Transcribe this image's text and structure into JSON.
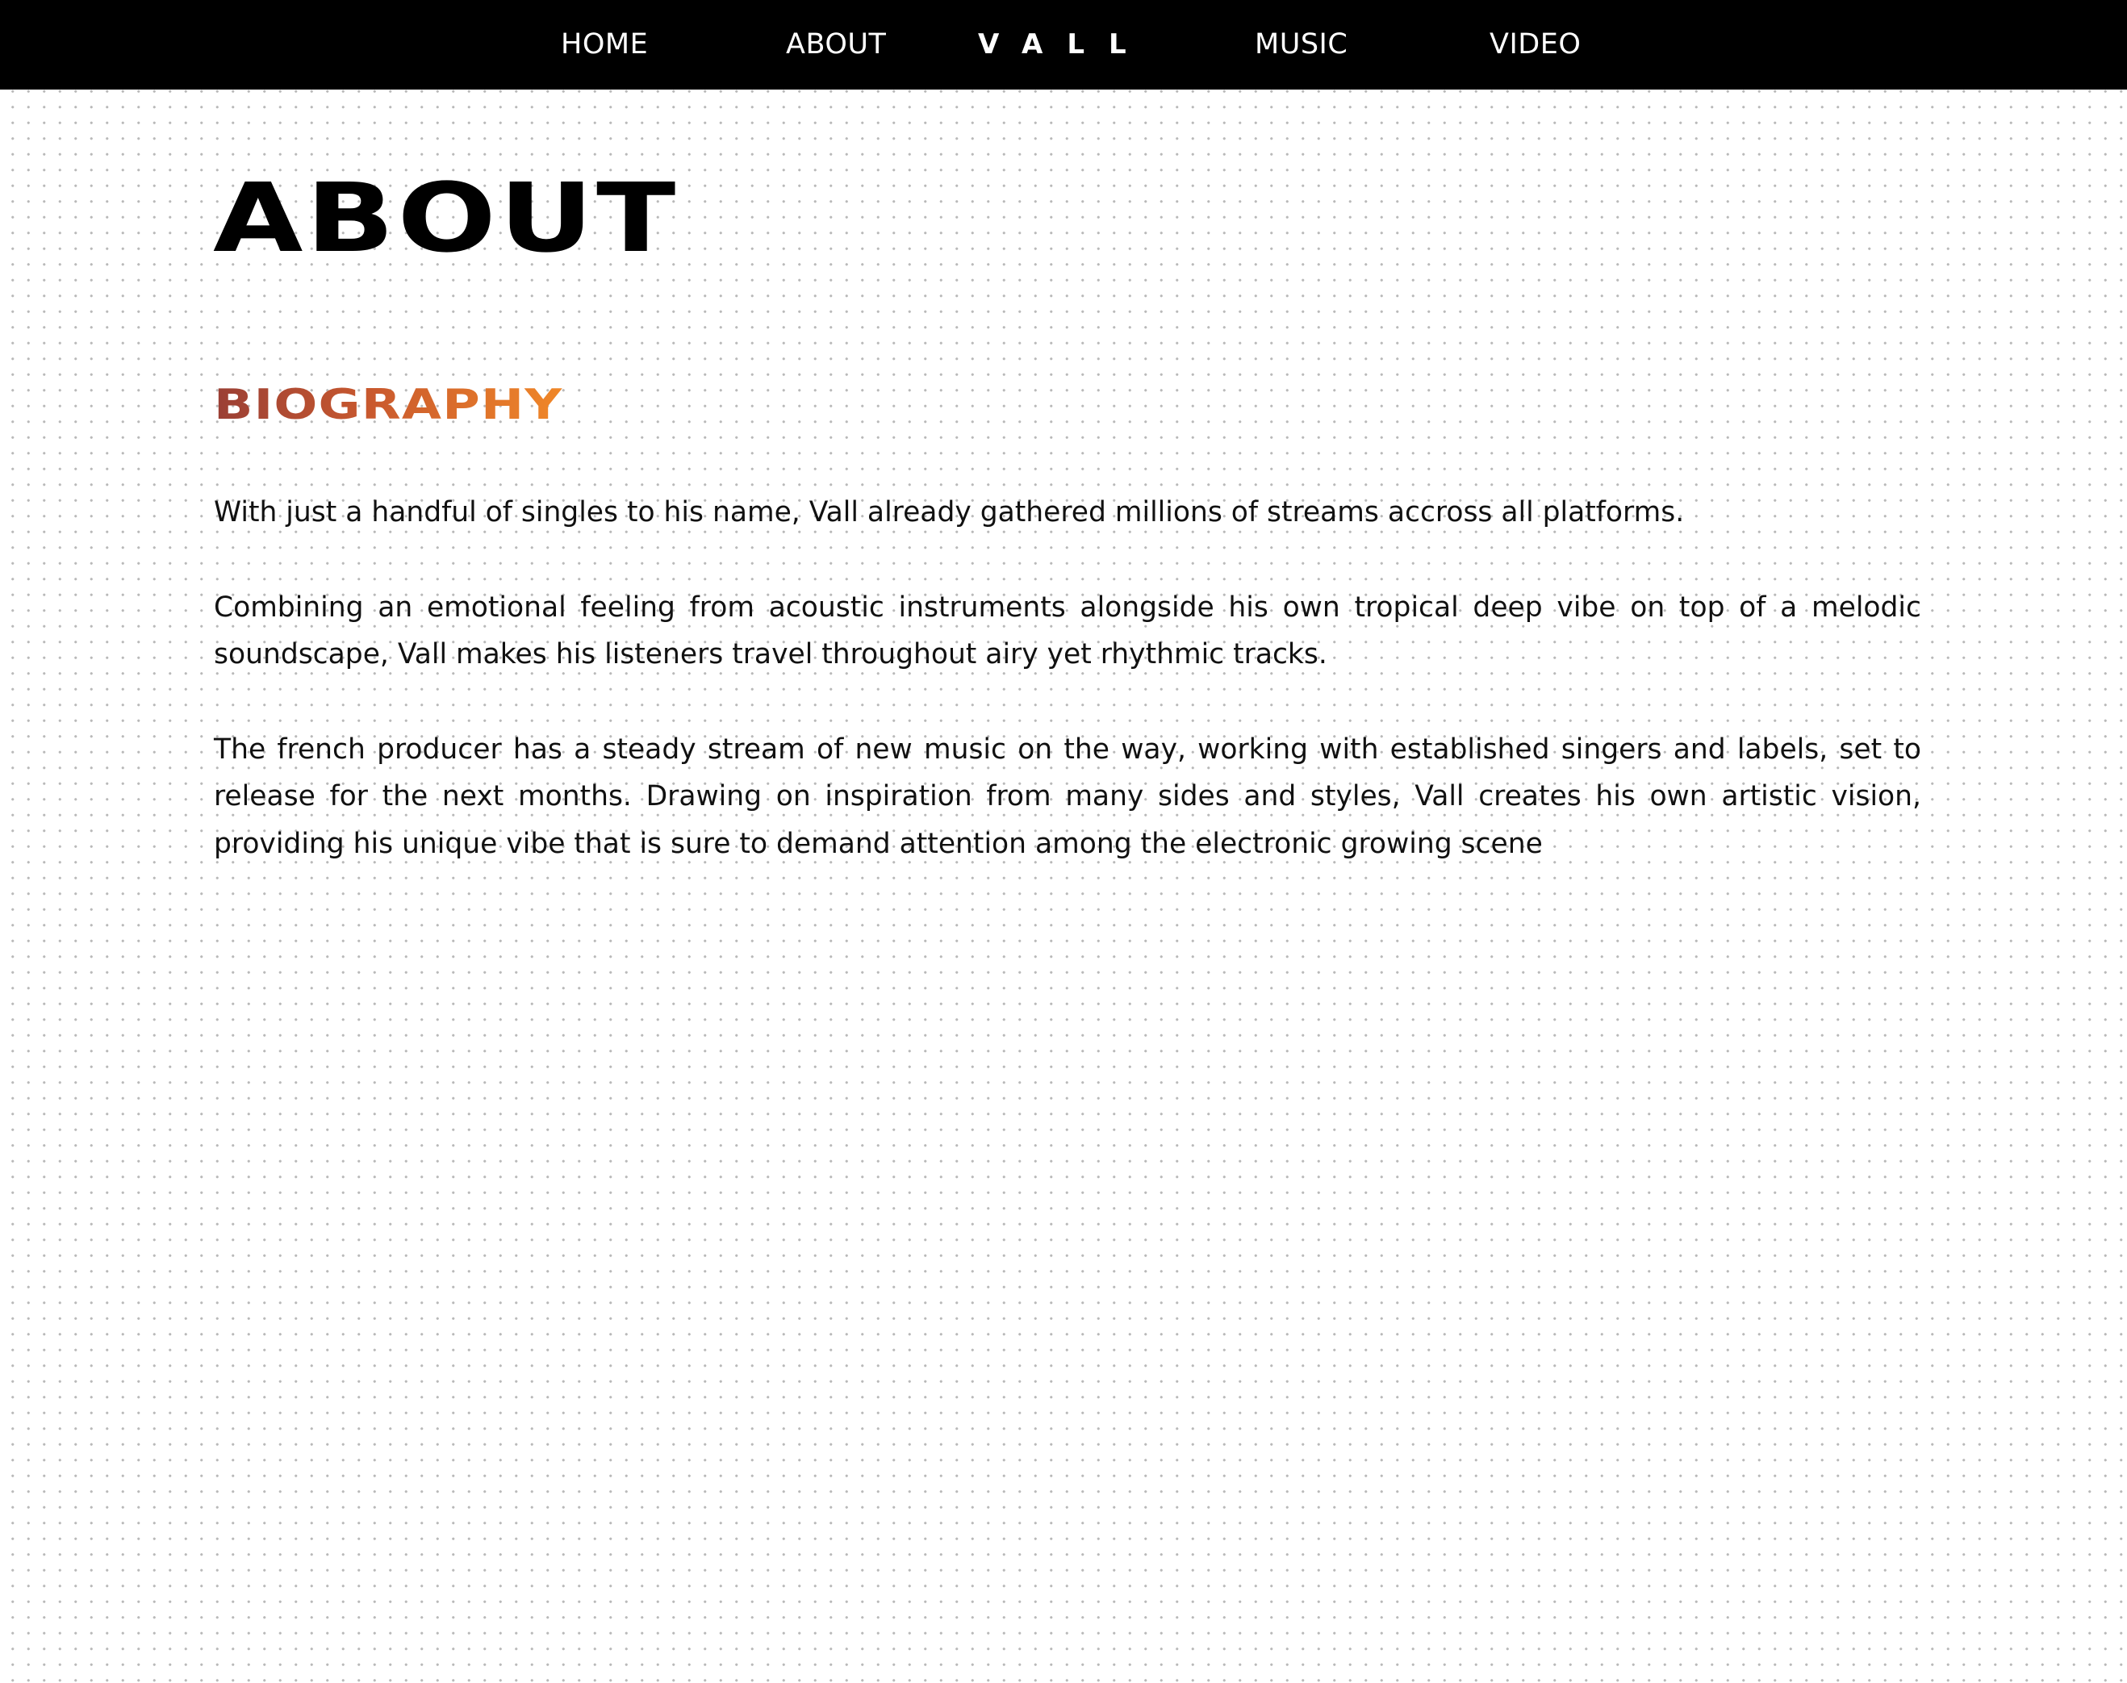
{
  "nav": {
    "home": "HOME",
    "about": "ABOUT",
    "logo": "VALL",
    "music": "MUSIC",
    "video": "VIDEO"
  },
  "page": {
    "title": "ABOUT"
  },
  "biography": {
    "heading": "BIOGRAPHY",
    "gradient_colors": [
      "#9a3f35",
      "#f08728"
    ],
    "paragraphs": [
      "With just a handful of singles to his name, Vall already gathered millions of streams accross all platforms.",
      "Combining an emotional feeling from acoustic instruments alongside his own tropical deep vibe on top of a melodic soundscape, Vall makes his listeners travel throughout airy yet rhythmic tracks.",
      "The french producer has a steady stream of new music on the way, working with established singers and labels, set to release for the next months. Drawing on inspiration from many sides and styles, Vall creates his own artistic vision, providing his unique vibe that is sure to demand attention among the electronic growing scene"
    ]
  }
}
